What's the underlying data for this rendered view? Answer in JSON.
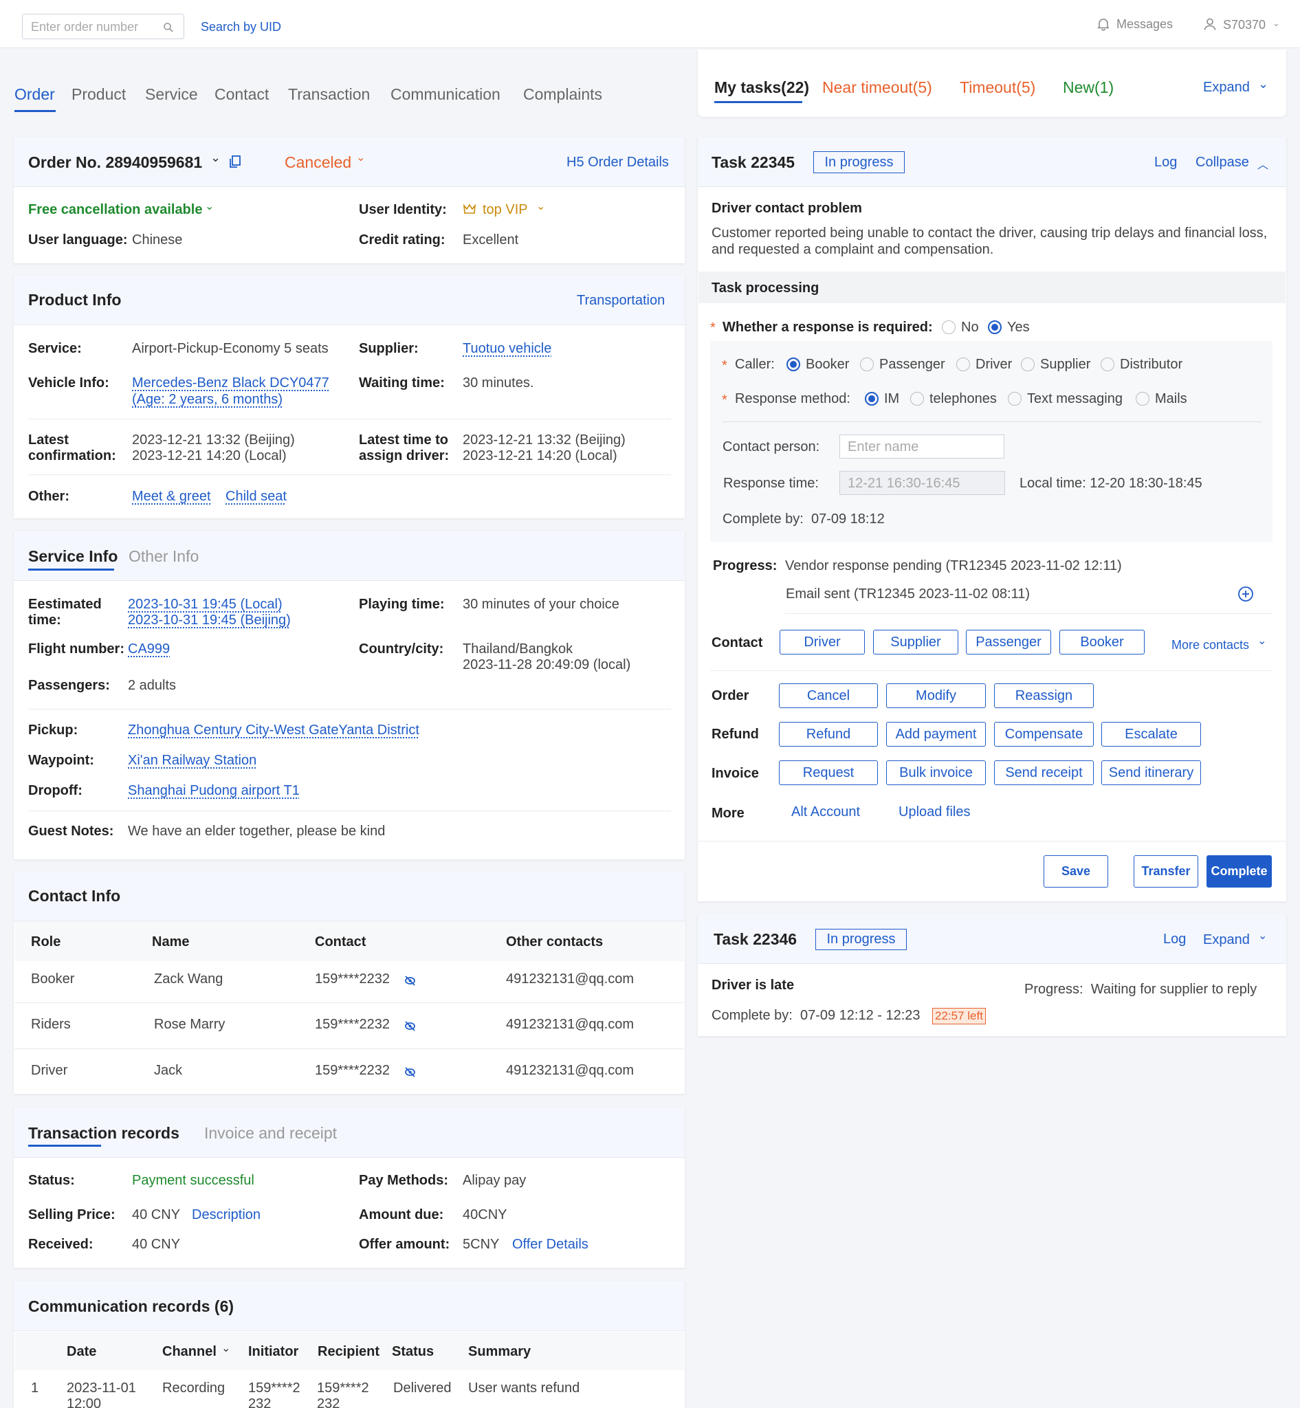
{
  "topbar": {
    "order_placeholder": "Enter order number",
    "search_uid": "Search by UID",
    "messages": "Messages",
    "user": "S70370"
  },
  "nav_tabs": [
    "Order",
    "Product",
    "Service",
    "Contact",
    "Transaction",
    "Communication",
    "Complaints"
  ],
  "task_tabs": {
    "my": "My tasks(22)",
    "near": "Near timeout(5)",
    "timeout": "Timeout(5)",
    "new": "New(1)",
    "expand": "Expand"
  },
  "order": {
    "number": "Order No. 28940959681",
    "status": "Canceled",
    "h5": "H5 Order Details",
    "free_cancel": "Free cancellation available",
    "identity_label": "User Identity:",
    "identity_value": "top VIP",
    "lang_label": "User language:",
    "lang_value": "Chinese",
    "credit_label": "Credit rating:",
    "credit_value": "Excellent"
  },
  "product": {
    "title": "Product Info",
    "category": "Transportation",
    "service_label": "Service:",
    "service_value": "Airport-Pickup-Economy 5 seats",
    "supplier_label": "Supplier:",
    "supplier_value": "Tuotuo vehicle",
    "vehicle_label": "Vehicle Info:",
    "vehicle_line1": "Mercedes-Benz Black DCY0477",
    "vehicle_line2": "(Age: 2 years, 6 months)",
    "waiting_label": "Waiting time:",
    "waiting_value": "30 minutes.",
    "latest_conf_l1": "Latest",
    "latest_conf_l2": "confirmation:",
    "latest_conf_v1": "2023-12-21 13:32 (Beijing)",
    "latest_conf_v2": "2023-12-21 14:20 (Local)",
    "assign_l1": "Latest time to",
    "assign_l2": "assign driver:",
    "assign_v1": "2023-12-21 13:32 (Beijing)",
    "assign_v2": "2023-12-21 14:20 (Local)",
    "other_label": "Other:",
    "other_1": "Meet & greet",
    "other_2": "Child seat"
  },
  "service": {
    "tab1": "Service Info",
    "tab2": "Other Info",
    "est_l1": "Eestimated",
    "est_l2": "time:",
    "est_v1": "2023-10-31 19:45 (Local)",
    "est_v2": "2023-10-31 19:45 (Beijing)",
    "playing_label": "Playing time:",
    "playing_value": "30 minutes of your choice",
    "flight_label": "Flight number:",
    "flight_value": "CA999",
    "country_label": "Country/city:",
    "country_v1": "Thailand/Bangkok",
    "country_v2": "2023-11-28 20:49:09 (local)",
    "pax_label": "Passengers:",
    "pax_value": "2 adults",
    "pickup_label": "Pickup:",
    "pickup_value": "Zhonghua Century City-West GateYanta District",
    "waypoint_label": "Waypoint:",
    "waypoint_value": "Xi'an Railway Station",
    "dropoff_label": "Dropoff:",
    "dropoff_value": "Shanghai Pudong airport T1",
    "notes_label": "Guest Notes:",
    "notes_value": "We have an elder together, please be kind"
  },
  "contact": {
    "title": "Contact Info",
    "headers": [
      "Role",
      "Name",
      "Contact",
      "Other contacts"
    ],
    "rows": [
      [
        "Booker",
        "Zack Wang",
        "159****2232",
        "491232131@qq.com"
      ],
      [
        "Riders",
        "Rose Marry",
        "159****2232",
        "491232131@qq.com"
      ],
      [
        "Driver",
        "Jack",
        "159****2232",
        "491232131@qq.com"
      ]
    ]
  },
  "transaction": {
    "tab1": "Transaction records",
    "tab2": "Invoice and receipt",
    "status_label": "Status:",
    "status_value": "Payment successful",
    "pay_label": "Pay Methods:",
    "pay_value": "Alipay pay",
    "price_label": "Selling Price:",
    "price_value": "40 CNY",
    "price_link": "Description",
    "due_label": "Amount due:",
    "due_value": "40CNY",
    "received_label": "Received:",
    "received_value": "40 CNY",
    "offer_label": "Offer amount:",
    "offer_value": "5CNY",
    "offer_link": "Offer Details"
  },
  "comm": {
    "title": "Communication records (6)",
    "headers": [
      "Date",
      "Channel",
      "Initiator",
      "Recipient",
      "Status",
      "Summary"
    ],
    "row": {
      "idx": "1",
      "date1": "2023-11-01",
      "date2": "12:00",
      "channel": "Recording",
      "init1": "159****2",
      "init2": "232",
      "rec1": "159****2",
      "rec2": "232",
      "status": "Delivered",
      "summary": "User wants refund"
    }
  },
  "task1": {
    "title": "Task 22345",
    "status": "In progress",
    "log": "Log",
    "collapse": "Collpase",
    "problem_title": "Driver contact problem",
    "problem_desc": "Customer reported being unable to contact the driver, causing trip delays and financial loss, and requested a complaint and compensation.",
    "processing": "Task processing",
    "resp_req_label": "Whether a response is required:",
    "no": "No",
    "yes": "Yes",
    "caller_label": "Caller:",
    "callers": [
      "Booker",
      "Passenger",
      "Driver",
      "Supplier",
      "Distributor"
    ],
    "method_label": "Response method:",
    "methods": [
      "IM",
      "telephones",
      "Text messaging",
      "Mails"
    ],
    "contact_person_label": "Contact person:",
    "contact_person_placeholder": "Enter name",
    "resp_time_label": "Response time:",
    "resp_time_value": "12-21 16:30-16:45",
    "local_time": "Local time: 12-20 18:30-18:45",
    "complete_by": "Complete by:  07-09 18:12",
    "progress_label": "Progress:",
    "progress_1": "Vendor response pending (TR12345 2023-11-02 12:11)",
    "progress_2": "Email sent (TR12345 2023-11-02 08:11)",
    "contact_label": "Contact",
    "contact_btns": [
      "Driver",
      "Supplier",
      "Passenger",
      "Booker"
    ],
    "more_contacts": "More contacts",
    "order_label": "Order",
    "order_btns": [
      "Cancel",
      "Modify",
      "Reassign"
    ],
    "refund_label": "Refund",
    "refund_btns": [
      "Refund",
      "Add payment",
      "Compensate",
      "Escalate"
    ],
    "invoice_label": "Invoice",
    "invoice_btns": [
      "Request",
      "Bulk invoice",
      "Send receipt",
      "Send itinerary"
    ],
    "more_label": "More",
    "alt_account": "Alt Account",
    "upload_files": "Upload files",
    "save": "Save",
    "transfer": "Transfer",
    "complete": "Complete"
  },
  "task2": {
    "title": "Task 22346",
    "status": "In progress",
    "log": "Log",
    "expand": "Expand",
    "problem": "Driver is late",
    "progress": "Progress:  Waiting for supplier to reply",
    "complete_by": "Complete by:  07-09 12:12 - 12:23",
    "left": "22:57 left"
  },
  "colors": {
    "accent": "#1f5cc9",
    "green": "#1e8a2e",
    "orange": "#e8612c",
    "vip": "#c98a0b"
  }
}
